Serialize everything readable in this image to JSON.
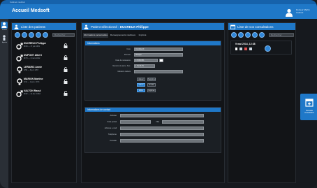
{
  "titlebar": {
    "strip_text": "Cabinet médical"
  },
  "header": {
    "title": "Accueil Medsoft",
    "user_name": "Docteur Martin Cabinet"
  },
  "nav": {
    "items": [
      {
        "label": "Patients"
      },
      {
        "label": "Agenda"
      }
    ]
  },
  "patients_panel": {
    "title": "Liste des patients",
    "search_placeholder": "Rechercher",
    "patients": [
      {
        "name": "DUCREUX Philippe",
        "sub": "M/64 — 17 juin 1951"
      },
      {
        "name": "DUPONT Albert",
        "sub": "M/73 — 3 mars 1942"
      },
      {
        "name": "LERARIC Annie",
        "sub": "F/58 — 8 juil. 1957"
      },
      {
        "name": "MARION Martine",
        "sub": "F/41 — 2 janv. 1974"
      },
      {
        "name": "VALTON Raoul",
        "sub": "M/52 — 11 déc. 1963"
      }
    ]
  },
  "patient_panel": {
    "title": "Patient sélectionné :",
    "patient_name": "DUCREUX Philippe",
    "tabs": [
      "Informations personnelles",
      "Renseignements médicaux",
      "Imprimé"
    ],
    "info_section": {
      "title": "Informations",
      "fields": [
        {
          "label": "Nom",
          "value": "DUCREUX"
        },
        {
          "label": "Prénom",
          "value": "Philippe"
        },
        {
          "label": "Date de naissance",
          "value": "17/06/1951"
        },
        {
          "label": "Numéro de sécu. Soc.",
          "value": "1 51 06 75"
        },
        {
          "label": "Médecin traitant",
          "value": ""
        }
      ],
      "buttons": [
        {
          "label": "Ajouter"
        },
        {
          "label": "Supprimer"
        },
        {
          "label": "Valider"
        },
        {
          "label": "Annuler"
        },
        {
          "label": "Éditer"
        },
        {
          "label": "Imprimer"
        }
      ]
    },
    "contact_section": {
      "title": "Informations de contact",
      "fields": [
        {
          "label": "Adresse",
          "value": ""
        },
        {
          "label": "Code postal",
          "value": ""
        },
        {
          "label": "Ville",
          "value": ""
        },
        {
          "label": "Adresse e-mail",
          "value": ""
        },
        {
          "label": "Téléphone",
          "value": ""
        },
        {
          "label": "Portable",
          "value": ""
        }
      ]
    }
  },
  "consult_panel": {
    "title": "Liste de vos consultations",
    "search_placeholder": "Rechercher",
    "consultations": [
      {
        "date": "9 mai 2014, 12:38"
      }
    ]
  },
  "side_action": {
    "label": "Nouvelle consultation"
  },
  "colors": {
    "accent": "#1f78c8",
    "background": "#16191e"
  },
  "icons": [
    "user-icon",
    "lock-icon",
    "male-icon",
    "calendar-icon",
    "edit-icon",
    "search-icon"
  ]
}
